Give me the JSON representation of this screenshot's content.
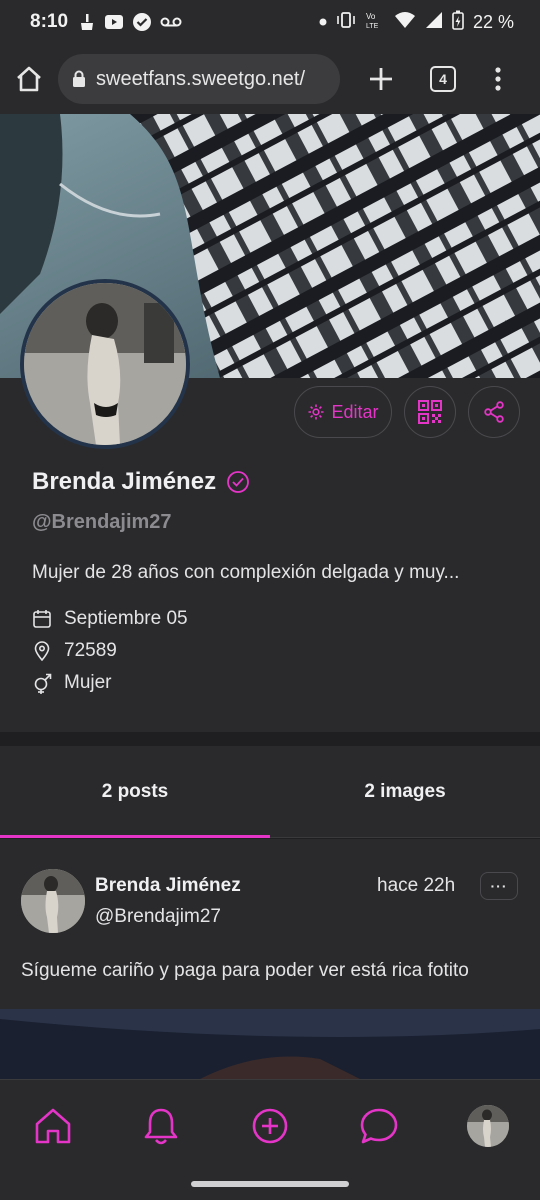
{
  "status_bar": {
    "time": "8:10",
    "battery": "22 %",
    "icons": [
      "broom-icon",
      "youtube-icon",
      "check-circle-icon",
      "voicemail-icon",
      "dot-icon",
      "vibrate-icon",
      "volte-icon",
      "wifi-icon",
      "signal-icon",
      "battery-icon"
    ]
  },
  "browser": {
    "url": "sweetfans.sweetgo.net/",
    "tab_count": "4"
  },
  "profile": {
    "name": "Brenda Jiménez",
    "handle": "@Brendajim27",
    "bio": "Mujer de 28 años con complexión delgada y muy...",
    "birthday": "Septiembre 05",
    "location": "72589",
    "gender": "Mujer",
    "edit_label": "Editar"
  },
  "tabs": [
    {
      "label": "2 posts",
      "active": true
    },
    {
      "label": "2 images",
      "active": false
    }
  ],
  "post": {
    "author": "Brenda Jiménez",
    "handle": "@Brendajim27",
    "time": "hace 22h",
    "more_label": "···",
    "text": "Sígueme cariño y paga para poder ver está rica fotito"
  },
  "colors": {
    "accent": "#e535c8",
    "background": "#1f1f21",
    "surface": "#2a2a2c",
    "muted_text": "#8b8b90"
  },
  "bottom_nav": [
    "home-icon",
    "bell-icon",
    "plus-circle-icon",
    "chat-icon",
    "profile-avatar"
  ]
}
